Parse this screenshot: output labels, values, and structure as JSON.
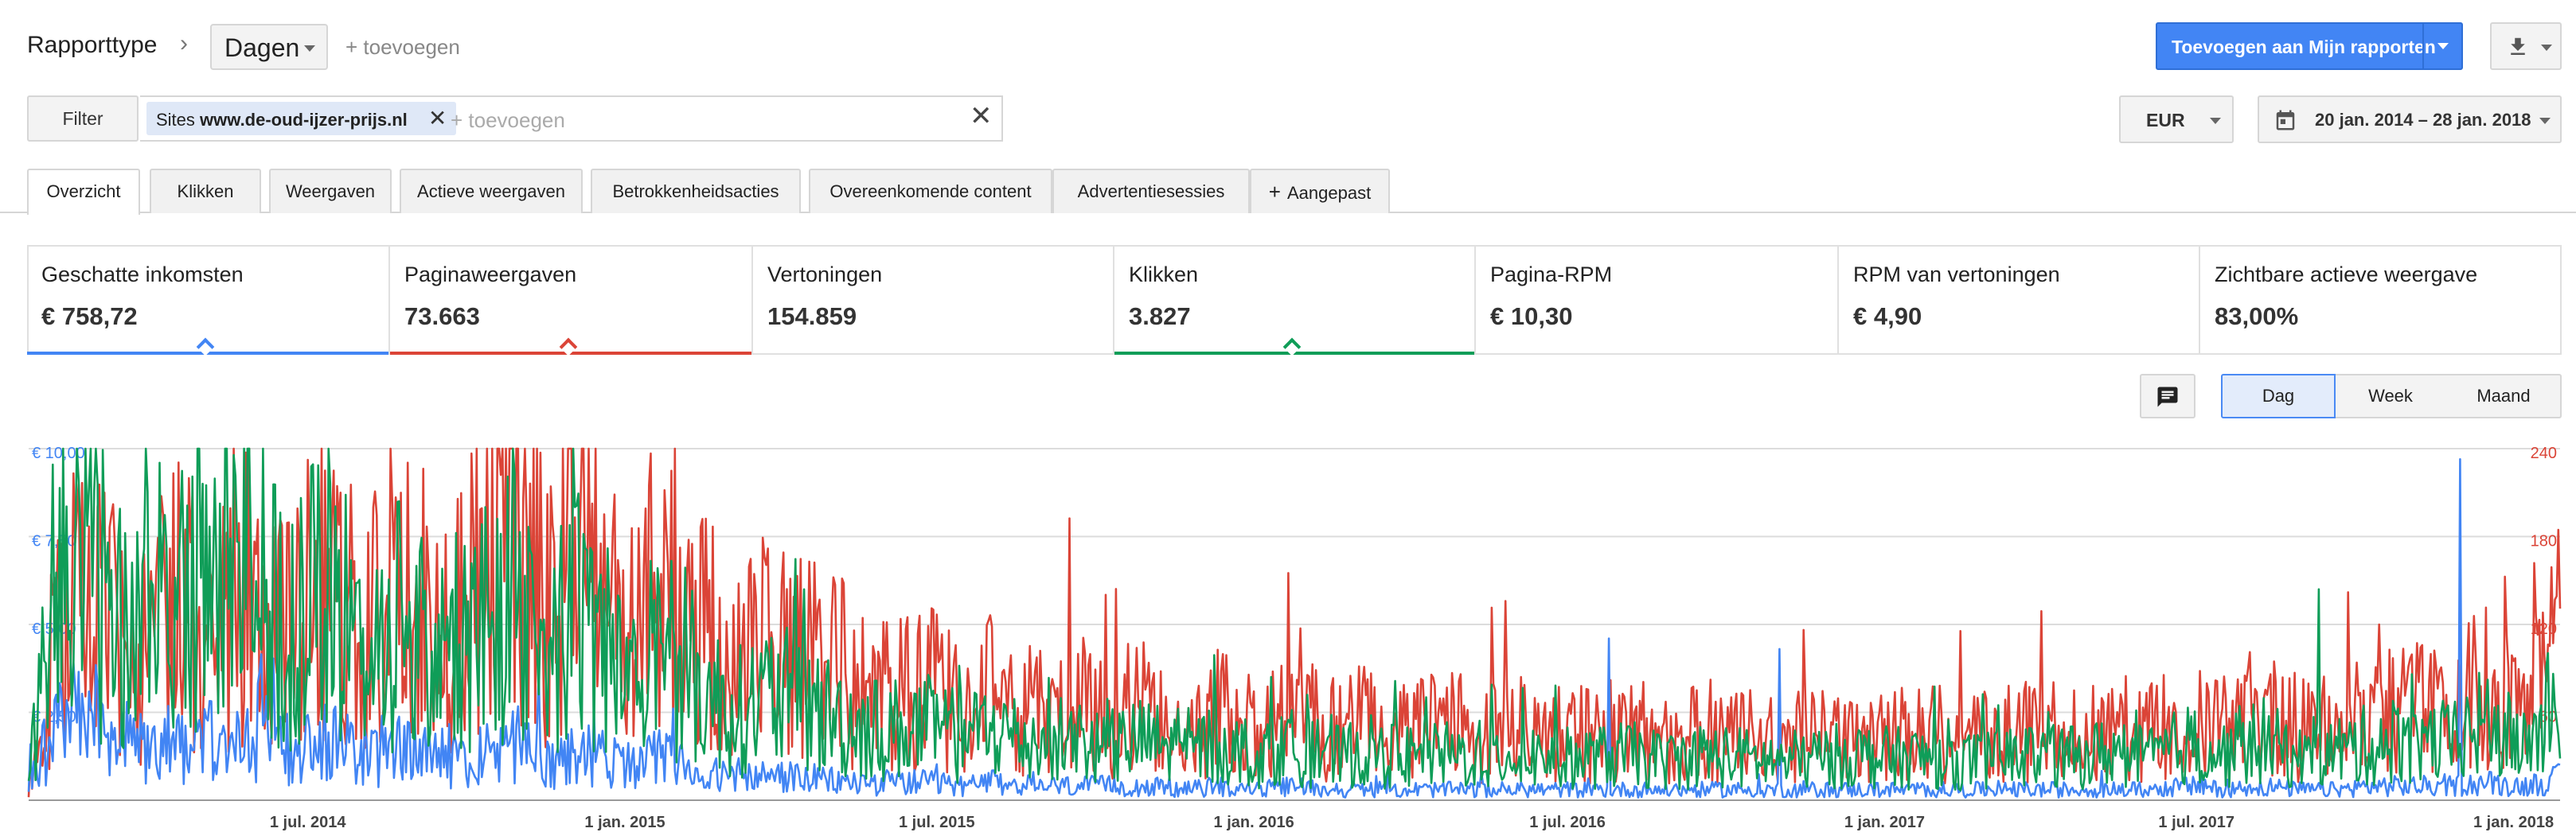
{
  "header": {
    "title": "Rapporttype",
    "report_dropdown": "Dagen",
    "add_link": "+ toevoegen",
    "primary_button": "Toevoegen aan Mijn rapporten"
  },
  "filters": {
    "filter_label": "Filter",
    "chip_prefix": "Sites",
    "chip_value": "www.de-oud-ijzer-prijs.nl",
    "placeholder": "+ toevoegen",
    "currency": "EUR",
    "date_range": "20 jan. 2014 – 28 jan. 2018"
  },
  "tabs": [
    {
      "label": "Overzicht",
      "active": true
    },
    {
      "label": "Klikken"
    },
    {
      "label": "Weergaven"
    },
    {
      "label": "Actieve weergaven"
    },
    {
      "label": "Betrokkenheidsacties"
    },
    {
      "label": "Overeenkomende content"
    },
    {
      "label": "Advertentiesessies"
    },
    {
      "label": "Aangepast",
      "icon": "plus-icon"
    }
  ],
  "metrics": [
    {
      "name": "Geschatte inkomsten",
      "value": "€ 758,72",
      "selected_color": "#4285f4"
    },
    {
      "name": "Paginaweergaven",
      "value": "73.663",
      "selected_color": "#db4437"
    },
    {
      "name": "Vertoningen",
      "value": "154.859"
    },
    {
      "name": "Klikken",
      "value": "3.827",
      "selected_color": "#0f9d58"
    },
    {
      "name": "Pagina-RPM",
      "value": "€ 10,30"
    },
    {
      "name": "RPM van vertoningen",
      "value": "€ 4,90"
    },
    {
      "name": "Zichtbare actieve weergave",
      "value": "83,00%"
    }
  ],
  "granularity": {
    "options": [
      "Dag",
      "Week",
      "Maand"
    ],
    "selected": "Dag"
  },
  "chart_data": {
    "type": "line",
    "x_range": [
      "2014-01-20",
      "2018-01-28"
    ],
    "x_ticks": [
      "1 jul. 2014",
      "1 jan. 2015",
      "1 jul. 2015",
      "1 jan. 2016",
      "1 jul. 2016",
      "1 jan. 2017",
      "1 jul. 2017",
      "1 jan. 2018"
    ],
    "x_tick_dates": [
      "2014-07-01",
      "2015-01-01",
      "2015-07-01",
      "2016-01-01",
      "2016-07-01",
      "2017-01-01",
      "2017-07-01",
      "2018-01-01"
    ],
    "y_left_ticks": [
      "€ 2,50",
      "€ 5,00",
      "€ 7,50",
      "€ 10,00"
    ],
    "y_left_range": [
      0,
      10
    ],
    "y_right_ticks": [
      "60",
      "120",
      "180",
      "240"
    ],
    "y_right_range": [
      0,
      240
    ],
    "grid": true,
    "series": [
      {
        "metric": "Paginaweergaven",
        "axis": "right",
        "color": "#db4437",
        "values": [
          5,
          130,
          125,
          95,
          140,
          105,
          150,
          120,
          155,
          110,
          160,
          95,
          140,
          210,
          130,
          190,
          100,
          180,
          120,
          90,
          110,
          95,
          85,
          70,
          80,
          65,
          75,
          60,
          72,
          58,
          65,
          55,
          62,
          50,
          58,
          48,
          55,
          45,
          52,
          46,
          50,
          48,
          45,
          50,
          44,
          48,
          46,
          42,
          45,
          47,
          44,
          46,
          43,
          45,
          48,
          44,
          50,
          46,
          60,
          50,
          62,
          48,
          52,
          58,
          66,
          60,
          80,
          55,
          110
        ],
        "peaks": [
          [
            "2014-02-08",
            175
          ],
          [
            "2014-07-20",
            210
          ],
          [
            "2014-09-14",
            175
          ],
          [
            "2017-10-15",
            120
          ],
          [
            "2017-12-10",
            100
          ]
        ]
      },
      {
        "metric": "Geschatte inkomsten",
        "axis": "left",
        "color": "#4285f4",
        "values": [
          0.5,
          2.6,
          2.2,
          1.5,
          1.8,
          1.6,
          2.0,
          1.4,
          1.7,
          1.3,
          1.5,
          1.2,
          1.4,
          1.6,
          1.2,
          1.4,
          0.9,
          1.2,
          0.8,
          0.6,
          0.7,
          0.6,
          0.5,
          0.5,
          0.5,
          0.4,
          0.5,
          0.4,
          0.4,
          0.4,
          0.4,
          0.3,
          0.4,
          0.3,
          0.4,
          0.3,
          0.3,
          0.3,
          0.3,
          0.3,
          0.3,
          0.3,
          0.3,
          0.3,
          0.3,
          0.3,
          0.3,
          0.3,
          0.3,
          0.3,
          0.3,
          0.3,
          0.3,
          0.3,
          0.3,
          0.3,
          0.3,
          0.3,
          0.4,
          0.3,
          0.4,
          0.3,
          0.3,
          0.4,
          0.4,
          0.4,
          0.5,
          0.4,
          0.6
        ],
        "peaks": [
          [
            "2016-07-25",
            4.6
          ],
          [
            "2016-11-01",
            4.3
          ],
          [
            "2017-12-01",
            9.7
          ]
        ]
      },
      {
        "metric": "Klikken",
        "axis": "left",
        "color": "#0f9d58",
        "values": [
          1.0,
          7.0,
          6.2,
          4.8,
          6.5,
          5.5,
          6.8,
          4.5,
          6.2,
          4.0,
          5.5,
          3.8,
          5.0,
          6.0,
          4.5,
          5.5,
          3.5,
          5.0,
          3.2,
          2.5,
          3.0,
          2.6,
          2.2,
          2.0,
          2.1,
          1.8,
          2.0,
          1.6,
          1.8,
          1.5,
          1.7,
          1.4,
          1.6,
          1.3,
          1.5,
          1.2,
          1.4,
          1.2,
          1.3,
          1.2,
          1.3,
          1.2,
          1.2,
          1.3,
          1.1,
          1.3,
          1.2,
          1.1,
          1.2,
          1.3,
          1.2,
          1.2,
          1.1,
          1.2,
          1.3,
          1.2,
          1.4,
          1.2,
          1.6,
          1.3,
          1.7,
          1.2,
          1.4,
          1.6,
          1.8,
          1.6,
          2.2,
          1.5,
          2.9
        ],
        "peaks": [
          [
            "2014-03-01",
            9.0
          ],
          [
            "2014-05-01",
            9.0
          ],
          [
            "2015-04-15",
            6.0
          ],
          [
            "2017-09-10",
            6.0
          ]
        ]
      }
    ]
  }
}
